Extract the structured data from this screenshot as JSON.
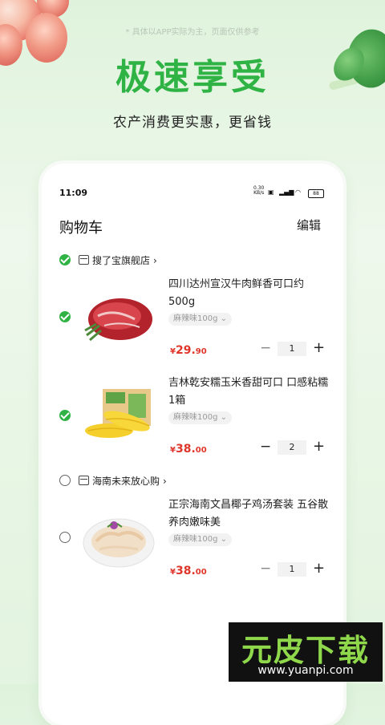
{
  "promo": {
    "note": "* 具体以APP实际为主，页面仅供参考",
    "title": "极速享受",
    "subtitle": "农产消费更实惠，更省钱"
  },
  "status_bar": {
    "time": "11:09",
    "net_speed": "0.30",
    "net_unit": "KB/s",
    "battery": "88"
  },
  "header": {
    "title": "购物车",
    "edit_label": "编辑"
  },
  "shops": [
    {
      "name": "搜了宝旗舰店",
      "checked": true
    },
    {
      "name": "海南未来放心购",
      "checked": false
    }
  ],
  "items": [
    {
      "name": "四川达州宣汉牛肉鲜香可口约500g",
      "spec": "麻辣味100g",
      "currency": "¥",
      "price_int": "29.",
      "price_dec": "90",
      "qty": "1",
      "checked": true,
      "minus": "−",
      "plus": "+"
    },
    {
      "name": "吉林乾安糯玉米香甜可口 口感粘糯1箱",
      "spec": "麻辣味100g",
      "currency": "¥",
      "price_int": "38.",
      "price_dec": "00",
      "qty": "2",
      "checked": true,
      "minus": "−",
      "plus": "+"
    },
    {
      "name": "正宗海南文昌椰子鸡汤套装 五谷散养肉嫩味美",
      "spec": "麻辣味100g",
      "currency": "¥",
      "price_int": "38.",
      "price_dec": "00",
      "qty": "1",
      "checked": false,
      "minus": "−",
      "plus": "+"
    }
  ],
  "watermark": {
    "brand": "元皮下载",
    "url": "www.yuanpi.com"
  },
  "colors": {
    "accent": "#2fb344",
    "price": "#e0362a"
  }
}
